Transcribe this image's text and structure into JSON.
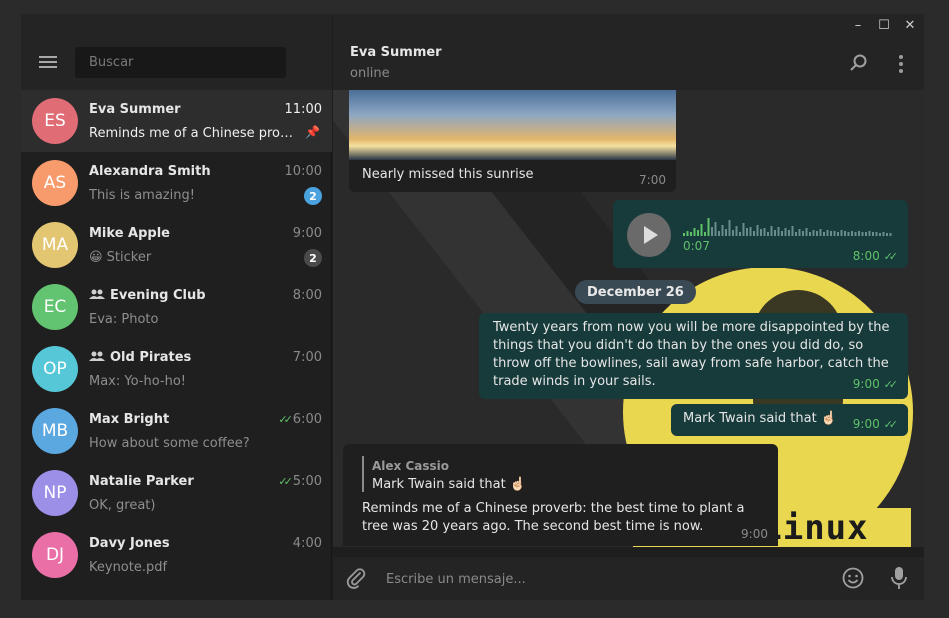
{
  "window": {
    "controls": [
      "–",
      "☐",
      "✕"
    ]
  },
  "search": {
    "placeholder": "Buscar"
  },
  "chats": [
    {
      "initials": "ES",
      "name": "Eva Summer",
      "time": "11:00",
      "message": "Reminds me of a Chinese proverb: the best time to plant a tree was 20 years ago. The second best time is now.",
      "color": "#e06c75",
      "pinned": true
    },
    {
      "initials": "AS",
      "name": "Alexandra Smith",
      "time": "10:00",
      "message": "This is amazing!",
      "color": "#f79b6d",
      "badge": "2",
      "badge_color": "#4aa3df"
    },
    {
      "initials": "MA",
      "name": "Mike Apple",
      "time": "9:00",
      "message": "😀 Sticker",
      "color": "#e3c672",
      "badge": "2",
      "badge_color": "#4a4a4a"
    },
    {
      "initials": "EC",
      "name": "Evening Club",
      "time": "8:00",
      "message": "Eva: Photo",
      "color": "#62c370",
      "group": true
    },
    {
      "initials": "OP",
      "name": "Old Pirates",
      "time": "7:00",
      "message": "Max: Yo-ho-ho!",
      "color": "#56c7d6",
      "group": true
    },
    {
      "initials": "MB",
      "name": "Max Bright",
      "time": "6:00",
      "message": "How about some coffee?",
      "color": "#5ba7e0",
      "read": true
    },
    {
      "initials": "NP",
      "name": "Natalie Parker",
      "time": "5:00",
      "message": "OK, great)",
      "color": "#9b8fe8",
      "read": true
    },
    {
      "initials": "DJ",
      "name": "Davy Jones",
      "time": "4:00",
      "message": "Keynote.pdf",
      "color": "#ea6fa6"
    }
  ],
  "main": {
    "title": "Eva Summer",
    "status": "online",
    "photo_caption": "Nearly missed this sunrise",
    "photo_time": "7:00",
    "voice_duration": "0:07",
    "voice_time": "8:00",
    "date_label": "December 26",
    "quote_text": "Twenty years from now you will be more disappointed by the things that you didn't do than by the ones you did do, so throw off the bowlines, sail away from safe harbor, catch the trade winds in your sails.",
    "quote_time": "9:00",
    "reply1_text": "Mark Twain said that ☝🏻",
    "reply1_time": "9:00",
    "reply2_author": "Alex Cassio",
    "reply2_quote": "Mark Twain said that ☝🏻",
    "reply2_text": "Reminds me of a Chinese proverb: the best time to plant a tree was 20 years ago. The second best time is now.",
    "reply2_time": "9:00",
    "wallpaper_text": "GNU/Linux",
    "composer_placeholder": "Escribe un mensaje..."
  },
  "colors": {
    "accent": "#5ec16a",
    "outgoing": "#173a3a",
    "incoming": "#1f1f1f"
  }
}
